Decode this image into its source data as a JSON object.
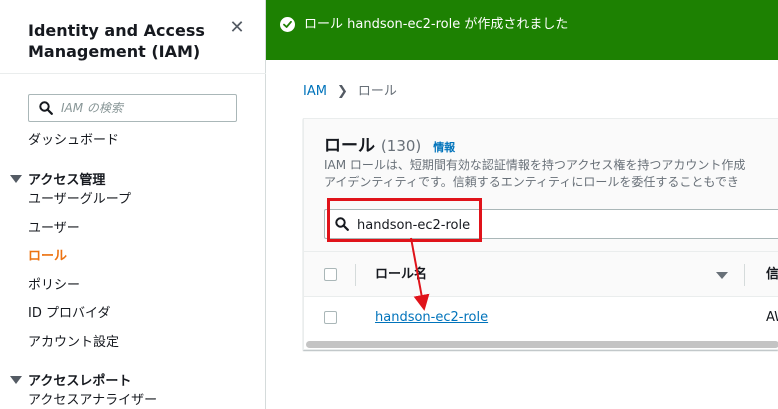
{
  "sidebar": {
    "title": "Identity and Access Management (IAM)",
    "close_icon": "close-icon",
    "search_placeholder": "IAM の検索",
    "dashboard": "ダッシュボード",
    "access_management": {
      "label": "アクセス管理",
      "items": [
        "ユーザーグループ",
        "ユーザー",
        "ロール",
        "ポリシー",
        "ID プロバイダ",
        "アカウント設定"
      ],
      "active_item": "ロール"
    },
    "access_reports": {
      "label": "アクセスレポート",
      "items": [
        "アクセスアナライザー"
      ]
    }
  },
  "banner": {
    "message": "ロール handson-ec2-role が作成されました",
    "icon": "check-circle-icon",
    "color": "#1d8102"
  },
  "breadcrumb": {
    "root": "IAM",
    "current": "ロール"
  },
  "roles_panel": {
    "title": "ロール",
    "count": "(130)",
    "info_link": "情報",
    "description_line1": "IAM ロールは、短期間有効な認証情報を持つアクセス権を持つアカウント作成",
    "description_line2": "アイデンティティです。信頼するエンティティにロールを委任することもでき",
    "search_value": "handson-ec2-role",
    "columns": {
      "role_name": "ロール名",
      "trusted_entity": "信"
    },
    "rows": [
      {
        "role_name": "handson-ec2-role",
        "trusted_entity": "AW"
      }
    ]
  },
  "colors": {
    "accent_link": "#0073bb",
    "active_nav": "#ec7211",
    "annotation": "#e0131a"
  }
}
